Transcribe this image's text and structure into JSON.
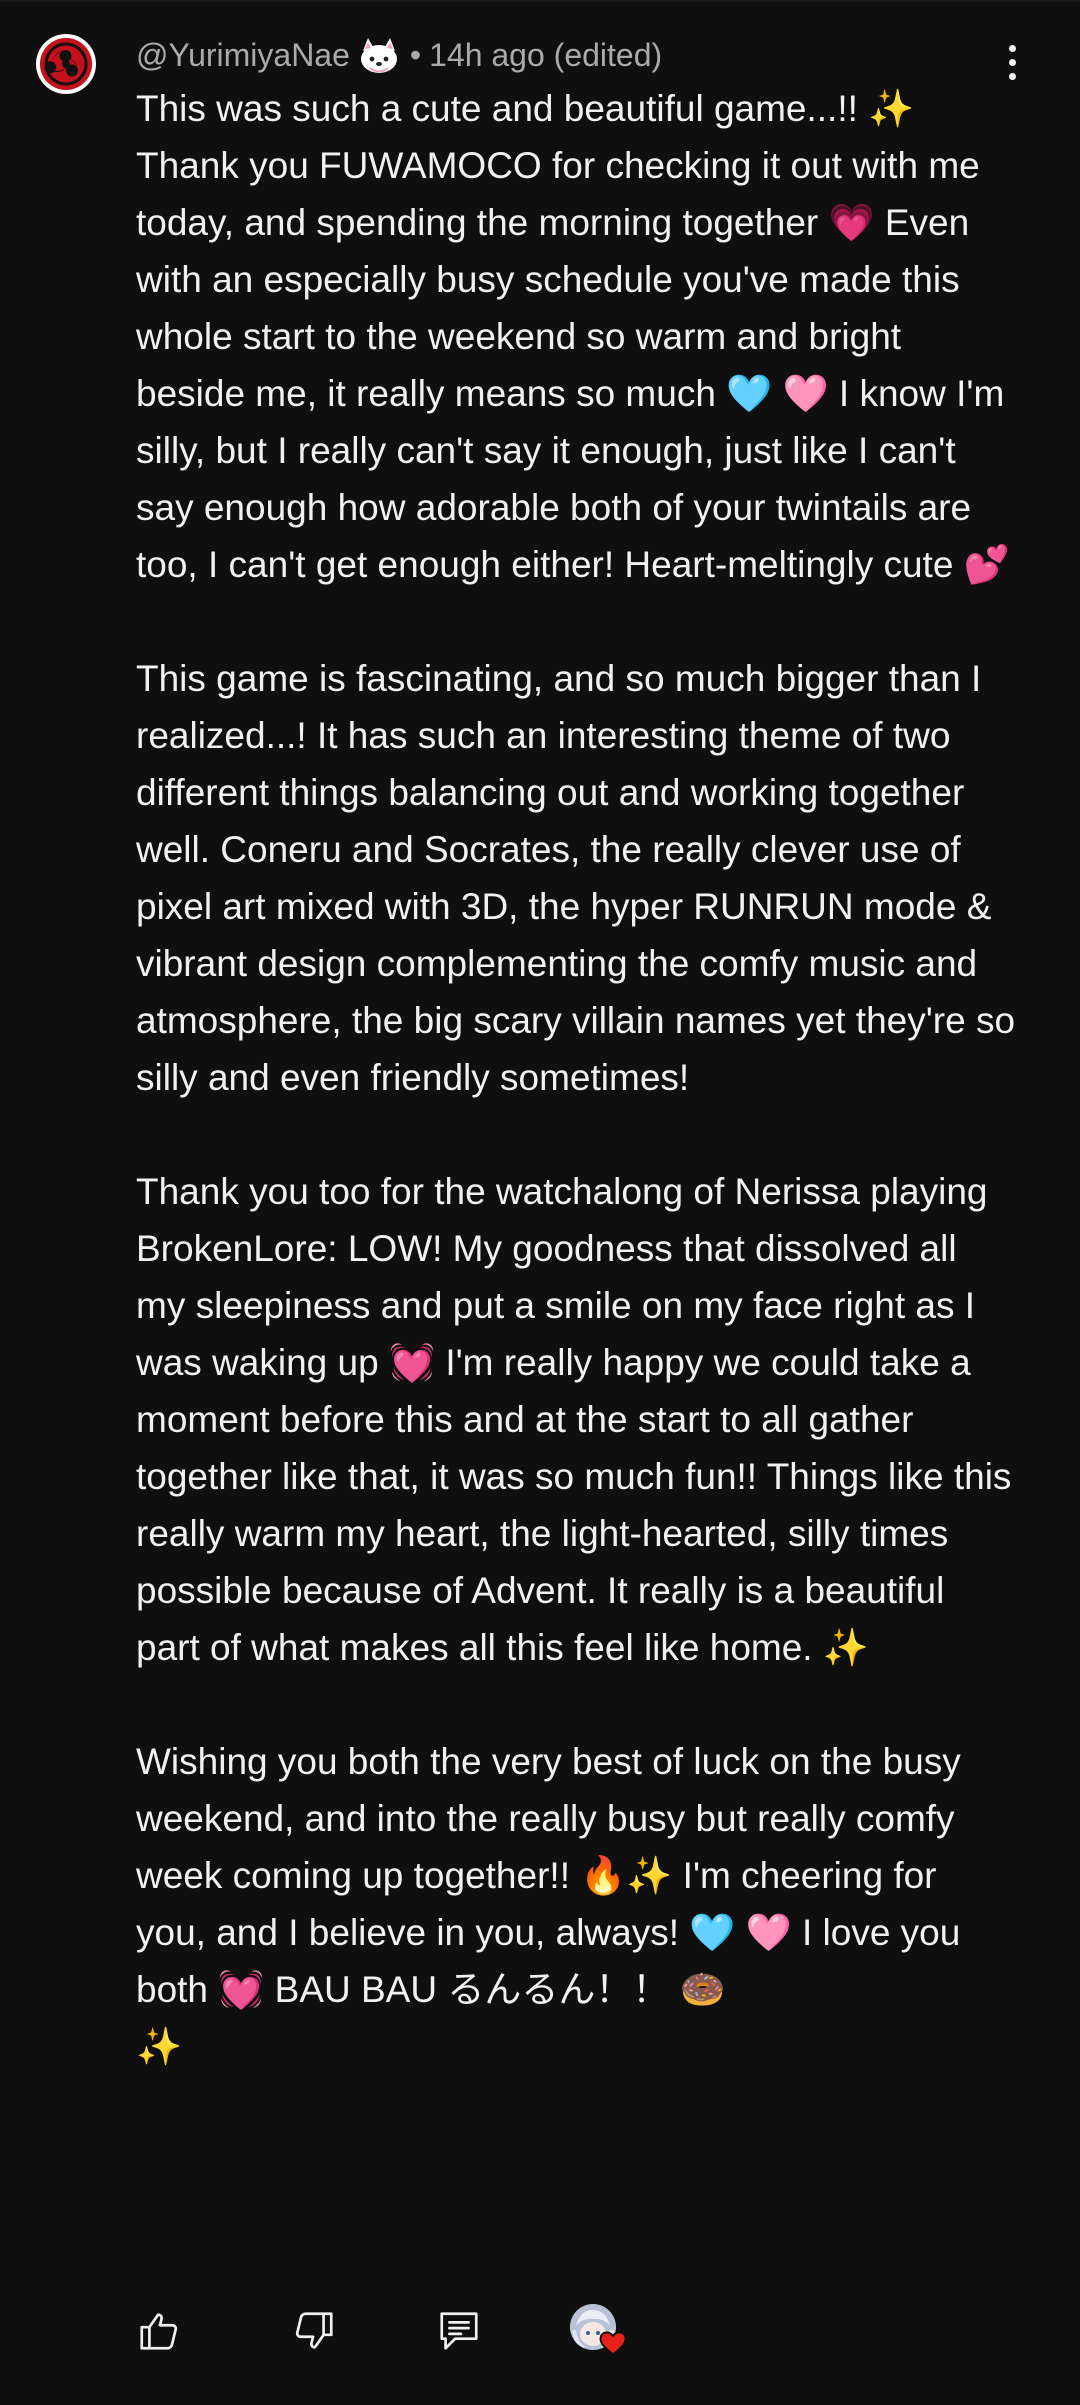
{
  "comment": {
    "author": "@YurimiyaNae",
    "meta_separator": "•",
    "timestamp": "14h ago (edited)",
    "text": "This was such a cute and beautiful game...!! ✨\nThank you FUWAMOCO for checking it out with me today, and spending the morning together 💗 Even with an especially busy schedule you've made this whole start to the weekend so warm and bright beside me, it really means so much 🩵 🩷 I know I'm silly, but I really can't say it enough, just like I can't say enough how adorable both of your twintails are too, I can't get enough either! Heart-meltingly cute 💕\n\nThis game is fascinating, and so much bigger than I realized...! It has such an interesting theme of two different things balancing out and working together well. Coneru and Socrates, the really clever use of pixel art mixed with 3D, the hyper RUNRUN mode & vibrant design complementing the comfy music and atmosphere, the big scary villain names yet they're so silly and even friendly sometimes!\n\nThank you too for the watchalong of Nerissa playing BrokenLore: LOW! My goodness that dissolved all my sleepiness and put a smile on my face right as I was waking up 💓 I'm really happy we could take a moment before this and at the start to all gather together like that, it was so much fun!! Things like this really warm my heart, the light-hearted, silly times possible because of Advent. It really is a beautiful part of what makes all this feel like home. ✨\n\nWishing you both the very best of luck on the busy weekend, and into the really busy but really comfy week coming up together!! 🔥✨ I'm cheering for you, and I believe in you, always! 🩵 🩷 I love you both 💓 BAU BAU るんるん！！ 🍩\n✨"
  },
  "icons": {
    "avatar": "tomoe-avatar",
    "badge": "dog-member-badge-icon",
    "more": "more-vertical-icon",
    "like": "thumbs-up-icon",
    "dislike": "thumbs-down-icon",
    "reply": "reply-comment-icon",
    "creator_heart": "creator-heart-icon"
  },
  "colors": {
    "background": "#0f0f0f",
    "text": "#f1f1f1",
    "meta": "#aaaaaa",
    "avatar_red": "#c4111b",
    "heart_red": "#e62117"
  }
}
